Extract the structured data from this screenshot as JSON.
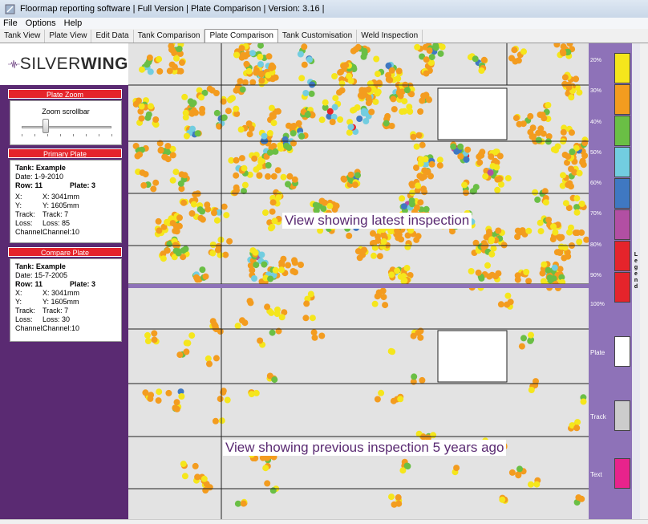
{
  "window": {
    "title": "Floormap reporting software | Full Version | Plate Comparison | Version: 3.16 |"
  },
  "menu": [
    "File",
    "Options",
    "Help"
  ],
  "tabs": [
    {
      "label": "Tank View",
      "active": false
    },
    {
      "label": "Plate View",
      "active": false
    },
    {
      "label": "Edit Data",
      "active": false
    },
    {
      "label": "Tank Comparison",
      "active": false
    },
    {
      "label": "Plate Comparison",
      "active": true
    },
    {
      "label": "Tank Customisation",
      "active": false
    },
    {
      "label": "Weld Inspection",
      "active": false
    }
  ],
  "logo": {
    "brand_light": "SILVER",
    "brand_bold": "WING"
  },
  "plate_zoom": {
    "header": "Plate Zoom",
    "label": "Zoom scrollbar",
    "value_fraction": 0.25
  },
  "primary_plate": {
    "header": "Primary Plate",
    "tank": "Tank: Example",
    "date": "Date: 1-9-2010",
    "row": "Row: 11",
    "plate": "Plate: 3",
    "fields": [
      {
        "key": "X:",
        "value": "X: 3041mm"
      },
      {
        "key": "Y:",
        "value": "Y: 1605mm"
      },
      {
        "key": "Track:",
        "value": "Track: 7"
      },
      {
        "key": "Loss:",
        "value": "Loss: 85"
      },
      {
        "key": "Channel:",
        "value": "Channel:10"
      }
    ]
  },
  "compare_plate": {
    "header": "Compare Plate",
    "tank": "Tank: Example",
    "date": "Date: 15-7-2005",
    "row": "Row: 11",
    "plate": "Plate: 3",
    "fields": [
      {
        "key": "X:",
        "value": "X: 3041mm"
      },
      {
        "key": "Y:",
        "value": "Y: 1605mm"
      },
      {
        "key": "Track:",
        "value": "Track: 7"
      },
      {
        "key": "Loss:",
        "value": "Loss: 30"
      },
      {
        "key": "Channel:",
        "value": "Channel:10"
      }
    ]
  },
  "views": {
    "latest_label": "View showing latest inspection",
    "previous_label": "View showing previous inspection 5 years ago"
  },
  "legend": {
    "title_letters": [
      "L",
      "e",
      "g",
      "e",
      "n",
      "d"
    ],
    "levels": [
      {
        "label": "20%",
        "color": "#f5e61c"
      },
      {
        "label": "30%",
        "color": "#f39c1f"
      },
      {
        "label": "40%",
        "color": "#6abf45"
      },
      {
        "label": "50%",
        "color": "#72cde0"
      },
      {
        "label": "60%",
        "color": "#3f78c2"
      },
      {
        "label": "70%",
        "color": "#b24fa3"
      },
      {
        "label": "80%",
        "color": "#e5242b"
      },
      {
        "label": "90%",
        "color": "#e5242b"
      },
      {
        "label": "100%",
        "color": ""
      }
    ],
    "extras": [
      {
        "label": "Plate",
        "color": "#ffffff"
      },
      {
        "label": "Track",
        "color": "#cccccc"
      },
      {
        "label": "Text",
        "color": "#e8238c"
      }
    ]
  }
}
